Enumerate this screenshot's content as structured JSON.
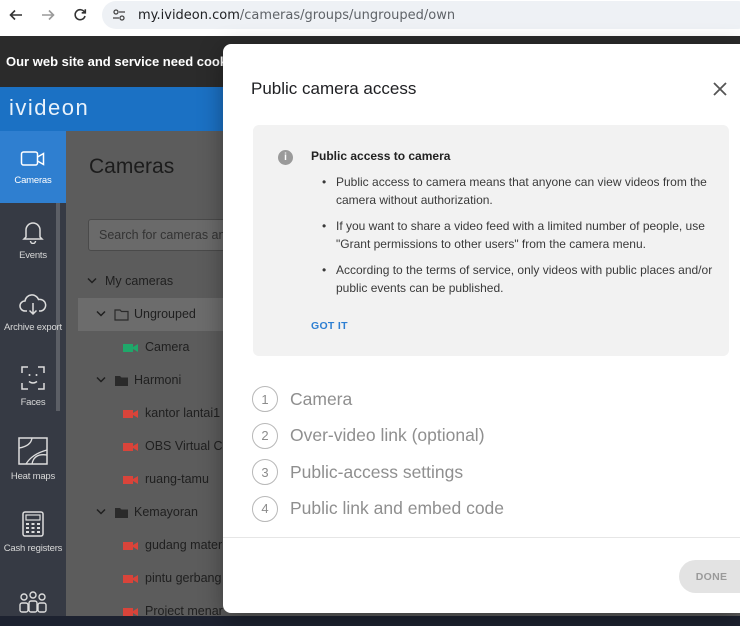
{
  "browser": {
    "url_host": "my.ivideon.com",
    "url_path": "/cameras/groups/ungrouped/own"
  },
  "cookie_bar": {
    "text": "Our web site and service need cookies"
  },
  "app": {
    "logo": "ivideon"
  },
  "sidebar": {
    "items": [
      {
        "label": "Cameras",
        "icon": "camera-icon",
        "active": true
      },
      {
        "label": "Events",
        "icon": "bell-icon"
      },
      {
        "label": "Archive export",
        "icon": "cloud-download-icon"
      },
      {
        "label": "Faces",
        "icon": "face-scan-icon"
      },
      {
        "label": "Heat maps",
        "icon": "heatmap-icon"
      },
      {
        "label": "Cash registers",
        "icon": "cash-register-icon"
      },
      {
        "label": "",
        "icon": "people-icon"
      }
    ]
  },
  "cameras": {
    "title": "Cameras",
    "search_placeholder": "Search for cameras and",
    "tree": [
      {
        "label": "My cameras",
        "level": 0,
        "type": "root"
      },
      {
        "label": "Ungrouped",
        "level": 1,
        "type": "folder-open",
        "selected": true
      },
      {
        "label": "Camera",
        "level": 2,
        "type": "camera",
        "status": "online"
      },
      {
        "label": "Harmoni",
        "level": 1,
        "type": "folder"
      },
      {
        "label": "kantor lantai1",
        "level": 2,
        "type": "camera",
        "status": "offline"
      },
      {
        "label": "OBS Virtual Ca",
        "level": 2,
        "type": "camera",
        "status": "offline"
      },
      {
        "label": "ruang-tamu",
        "level": 2,
        "type": "camera",
        "status": "offline"
      },
      {
        "label": "Kemayoran",
        "level": 1,
        "type": "folder"
      },
      {
        "label": "gudang mater",
        "level": 2,
        "type": "camera",
        "status": "offline"
      },
      {
        "label": "pintu gerbang",
        "level": 2,
        "type": "camera",
        "status": "offline"
      },
      {
        "label": "Project menar",
        "level": 2,
        "type": "camera",
        "status": "offline"
      }
    ]
  },
  "modal": {
    "title": "Public camera access",
    "info": {
      "title": "Public access to camera",
      "items": [
        "Public access to camera means that anyone can view videos from the camera without authorization.",
        "If you want to share a video feed with a limited number of people, use \"Grant permissions to other users\" from the camera menu.",
        "According to the terms of service, only videos with public places and/or public events can be published."
      ],
      "got_it": "GOT IT"
    },
    "steps": [
      {
        "num": "1",
        "label": "Camera"
      },
      {
        "num": "2",
        "label": "Over-video link (optional)"
      },
      {
        "num": "3",
        "label": "Public-access settings"
      },
      {
        "num": "4",
        "label": "Public link and embed code"
      }
    ],
    "done_label": "DONE"
  },
  "colors": {
    "accent": "#2d7fd2",
    "header": "#1b71c4",
    "camera_online": "#1fa86a",
    "camera_offline": "#d9443a"
  }
}
